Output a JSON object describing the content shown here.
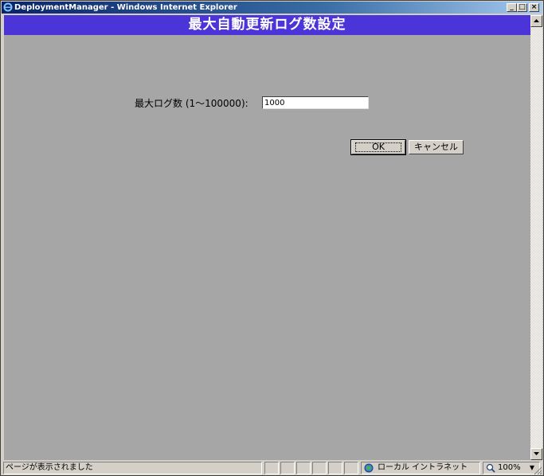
{
  "window": {
    "title": "DeploymentManager - Windows Internet Explorer",
    "controls": {
      "minimize": "_",
      "maximize": "□",
      "close": "×"
    }
  },
  "page": {
    "header": "最大自動更新ログ数設定",
    "field": {
      "label": "最大ログ数 (1〜100000):",
      "value": "1000"
    },
    "buttons": {
      "ok": "OK",
      "cancel": "キャンセル"
    }
  },
  "statusbar": {
    "text": "ページが表示されました",
    "zone": "ローカル イントラネット",
    "zoom": "100%",
    "zoom_arrow": "▼"
  },
  "colors": {
    "header_bg": "#4b35d8",
    "content_bg": "#a6a6a6",
    "titlebar_start": "#0a246a"
  },
  "icons": [
    "ie-logo-icon",
    "globe-icon",
    "zoom-icon",
    "scroll-up-arrow-icon",
    "scroll-down-arrow-icon",
    "resize-grip-icon"
  ]
}
